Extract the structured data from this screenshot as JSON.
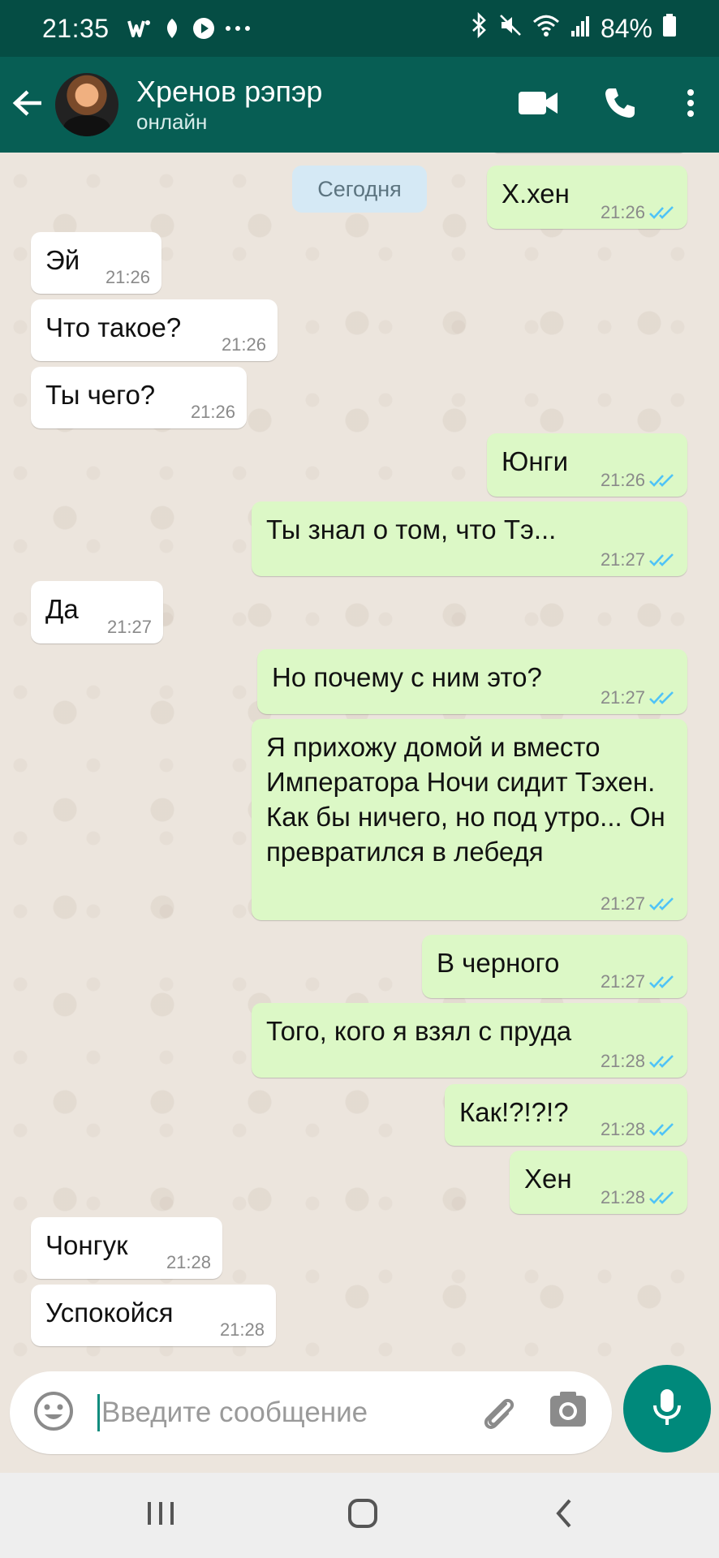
{
  "status_bar": {
    "time": "21:35",
    "battery": "84%"
  },
  "chat_header": {
    "contact_name": "Хренов рэпэр",
    "contact_status": "онлайн"
  },
  "day_divider": "Сегодня",
  "messages": [
    {
      "dir": "out",
      "text": "Х.хен",
      "time": "21:26",
      "read": true
    },
    {
      "dir": "in",
      "text": "Эй",
      "time": "21:26"
    },
    {
      "dir": "in",
      "text": "Что такое?",
      "time": "21:26"
    },
    {
      "dir": "in",
      "text": "Ты чего?",
      "time": "21:26"
    },
    {
      "dir": "out",
      "text": "Юнги",
      "time": "21:26",
      "read": true
    },
    {
      "dir": "out",
      "text": "Ты знал о том, что Тэ...",
      "time": "21:27",
      "read": true
    },
    {
      "dir": "in",
      "text": "Да",
      "time": "21:27"
    },
    {
      "dir": "out",
      "text": "Но почему с ним это?",
      "time": "21:27",
      "read": true
    },
    {
      "dir": "out",
      "text": "Я прихожу домой и вместо Императора Ночи сидит Тэхен. Как бы ничего, но под утро... Он превратился в лебедя",
      "time": "21:27",
      "read": true
    },
    {
      "dir": "out",
      "text": "В черного",
      "time": "21:27",
      "read": true
    },
    {
      "dir": "out",
      "text": "Того, кого я взял с пруда",
      "time": "21:28",
      "read": true
    },
    {
      "dir": "out",
      "text": "Как!?!?!?",
      "time": "21:28",
      "read": true
    },
    {
      "dir": "out",
      "text": "Хен",
      "time": "21:28",
      "read": true
    },
    {
      "dir": "in",
      "text": "Чонгук",
      "time": "21:28"
    },
    {
      "dir": "in",
      "text": "Успокойся",
      "time": "21:28"
    }
  ],
  "composer": {
    "placeholder": "Введите сообщение"
  },
  "icons": {
    "back": "arrow-left-icon",
    "video": "video-call-icon",
    "call": "phone-icon",
    "menu": "more-vert-icon",
    "emoji": "emoji-icon",
    "attach": "paperclip-icon",
    "camera": "camera-icon",
    "mic": "microphone-icon",
    "read_receipt": "double-check-icon"
  },
  "colors": {
    "header": "#075e54",
    "status_bar": "#054d44",
    "outgoing": "#dcf8c6",
    "incoming": "#ffffff",
    "read_tick": "#4fc3f7",
    "accent": "#00897b"
  }
}
